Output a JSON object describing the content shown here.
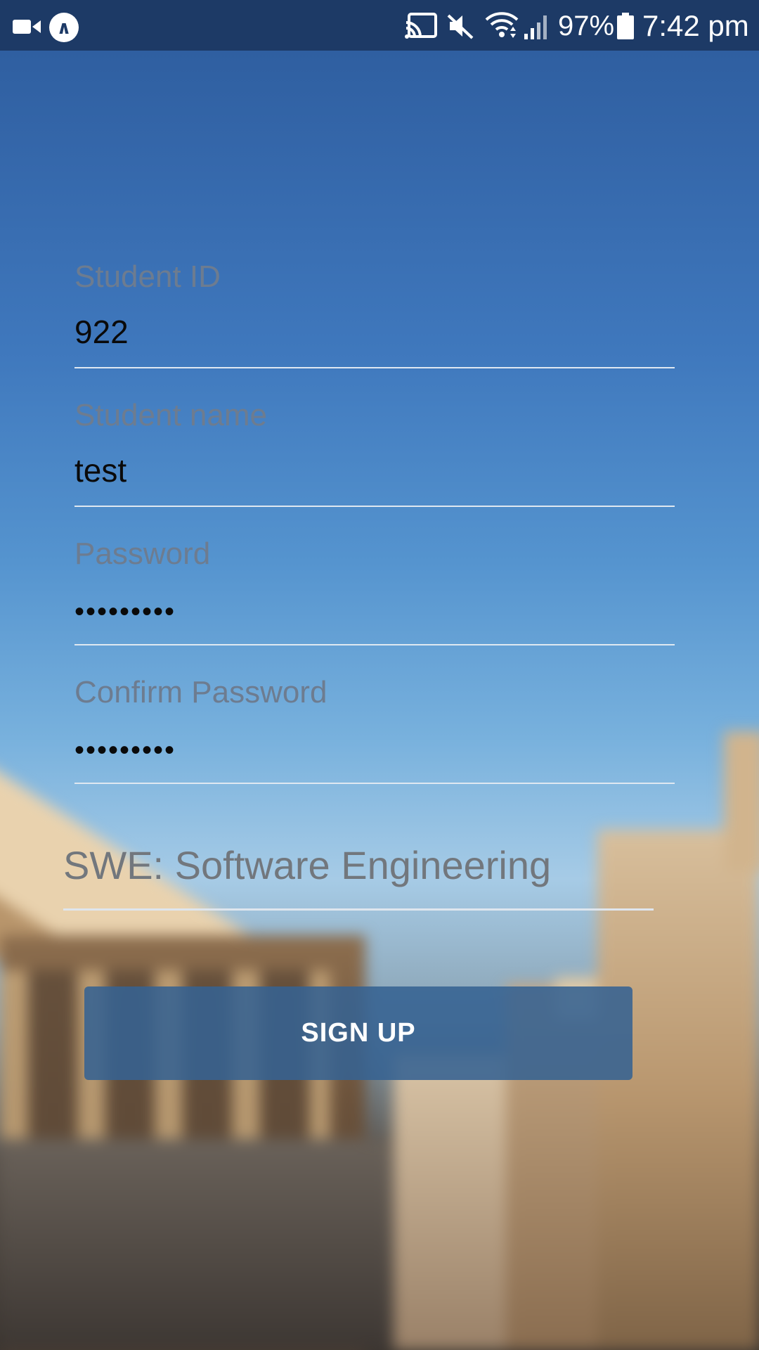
{
  "status_bar": {
    "battery_percent": "97%",
    "time": "7:42 pm",
    "icons": [
      "video-icon",
      "app-icon",
      "cast-icon",
      "mute-icon",
      "wifi-icon",
      "signal-icon",
      "battery-icon"
    ]
  },
  "form": {
    "student_id": {
      "label": "Student ID",
      "value": "922"
    },
    "student_name": {
      "label": "Student name",
      "value": "test"
    },
    "password": {
      "label": "Password",
      "value": "•••••••••"
    },
    "confirm_password": {
      "label": "Confirm Password",
      "value": "•••••••••"
    },
    "major": {
      "selected": "SWE: Software Engineering"
    },
    "signup_label": "SIGN UP"
  },
  "colors": {
    "status_bar": "#1d3a66",
    "label": "#6d7c90",
    "button": "#366292"
  }
}
